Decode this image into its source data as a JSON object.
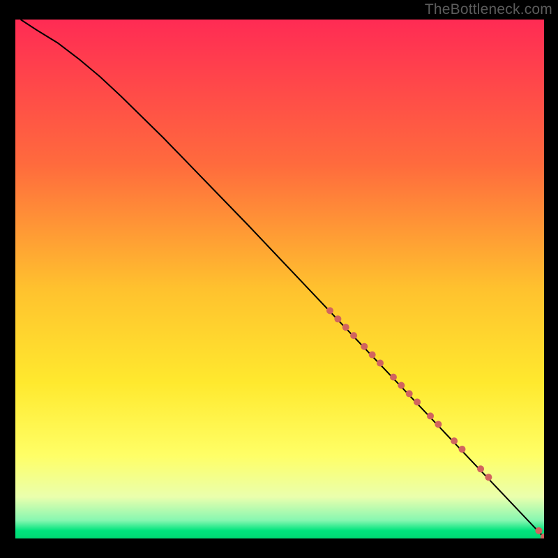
{
  "watermark": "TheBottleneck.com",
  "chart_data": {
    "type": "line",
    "title": "",
    "xlabel": "",
    "ylabel": "",
    "xlim": [
      0,
      100
    ],
    "ylim": [
      0,
      100
    ],
    "grid": false,
    "legend": false,
    "background_gradient_stops": [
      {
        "offset": 0.0,
        "color": "#ff2b54"
      },
      {
        "offset": 0.28,
        "color": "#ff6b3d"
      },
      {
        "offset": 0.52,
        "color": "#ffc22e"
      },
      {
        "offset": 0.7,
        "color": "#ffe92e"
      },
      {
        "offset": 0.84,
        "color": "#ffff66"
      },
      {
        "offset": 0.92,
        "color": "#eaffad"
      },
      {
        "offset": 0.965,
        "color": "#87f7b1"
      },
      {
        "offset": 0.985,
        "color": "#00e47d"
      },
      {
        "offset": 1.0,
        "color": "#00d873"
      }
    ],
    "curve": [
      {
        "x": 1.0,
        "y": 100.0
      },
      {
        "x": 4.0,
        "y": 98.0
      },
      {
        "x": 8.0,
        "y": 95.5
      },
      {
        "x": 12.0,
        "y": 92.4
      },
      {
        "x": 16.0,
        "y": 89.0
      },
      {
        "x": 20.0,
        "y": 85.2
      },
      {
        "x": 28.0,
        "y": 77.2
      },
      {
        "x": 36.0,
        "y": 68.8
      },
      {
        "x": 44.0,
        "y": 60.4
      },
      {
        "x": 52.0,
        "y": 51.8
      },
      {
        "x": 60.0,
        "y": 43.2
      },
      {
        "x": 68.0,
        "y": 34.6
      },
      {
        "x": 76.0,
        "y": 26.0
      },
      {
        "x": 84.0,
        "y": 17.4
      },
      {
        "x": 92.0,
        "y": 8.8
      },
      {
        "x": 100.0,
        "y": 0.2
      }
    ],
    "markers": [
      {
        "x": 59.5,
        "y": 43.9,
        "r": 5
      },
      {
        "x": 61.0,
        "y": 42.3,
        "r": 5
      },
      {
        "x": 62.5,
        "y": 40.7,
        "r": 5
      },
      {
        "x": 64.0,
        "y": 39.1,
        "r": 5
      },
      {
        "x": 66.0,
        "y": 37.0,
        "r": 5
      },
      {
        "x": 67.5,
        "y": 35.4,
        "r": 5
      },
      {
        "x": 69.0,
        "y": 33.8,
        "r": 5
      },
      {
        "x": 71.5,
        "y": 31.1,
        "r": 5
      },
      {
        "x": 73.0,
        "y": 29.5,
        "r": 5
      },
      {
        "x": 74.5,
        "y": 27.9,
        "r": 5
      },
      {
        "x": 76.0,
        "y": 26.3,
        "r": 5
      },
      {
        "x": 78.5,
        "y": 23.6,
        "r": 5
      },
      {
        "x": 80.0,
        "y": 22.0,
        "r": 5
      },
      {
        "x": 83.0,
        "y": 18.8,
        "r": 5
      },
      {
        "x": 84.5,
        "y": 17.2,
        "r": 5
      },
      {
        "x": 88.0,
        "y": 13.4,
        "r": 5
      },
      {
        "x": 89.5,
        "y": 11.8,
        "r": 5
      },
      {
        "x": 99.0,
        "y": 1.5,
        "r": 5
      },
      {
        "x": 100.0,
        "y": 0.3,
        "r": 5
      }
    ],
    "marker_color": "#d1645e",
    "line_color": "#000000"
  }
}
